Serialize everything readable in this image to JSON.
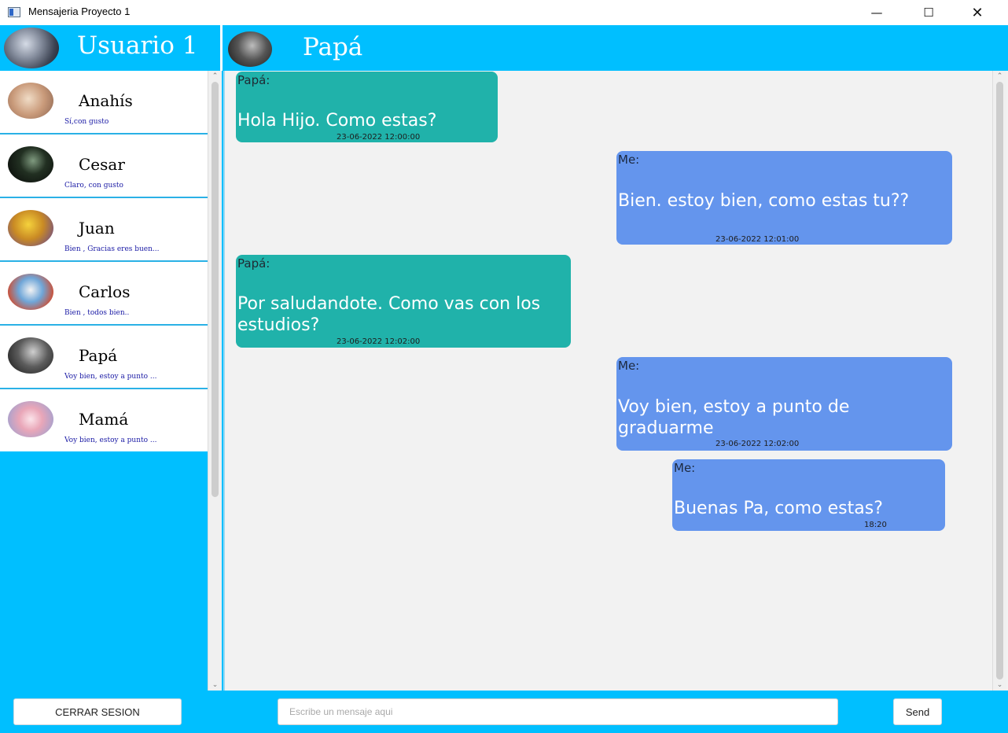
{
  "window": {
    "title": "Mensajeria Proyecto 1",
    "controls": {
      "minimize": "—",
      "maximize": "☐",
      "close": "✕"
    }
  },
  "header": {
    "user_name": "Usuario 1",
    "active_contact": "Papá"
  },
  "sidebar": {
    "chats": [
      {
        "name": "Anahís",
        "last_message": "Sí,con gusto"
      },
      {
        "name": "Cesar",
        "last_message": "Claro, con gusto"
      },
      {
        "name": "Juan",
        "last_message": "Bien , Gracias eres buen..."
      },
      {
        "name": "Carlos",
        "last_message": "Bien , todos bien.."
      },
      {
        "name": "Papá",
        "last_message": "Voy bien, estoy a punto ..."
      },
      {
        "name": "Mamá",
        "last_message": "Voy bien, estoy a punto ..."
      }
    ]
  },
  "messages": [
    {
      "sender": "Papá:",
      "direction": "in",
      "text": "Hola Hijo. Como estas?",
      "time": "23-06-2022 12:00:00"
    },
    {
      "sender": "Me:",
      "direction": "out",
      "text": "Bien. estoy bien, como estas tu??",
      "time": "23-06-2022 12:01:00"
    },
    {
      "sender": "Papá:",
      "direction": "in",
      "text": "Por saludandote. Como vas con los estudios?",
      "time": "23-06-2022 12:02:00"
    },
    {
      "sender": "Me:",
      "direction": "out",
      "text": "Voy bien, estoy a punto de graduarme",
      "time": "23-06-2022 12:02:00"
    },
    {
      "sender": "Me:",
      "direction": "out",
      "text": "Buenas Pa, como estas?",
      "time": "18:20"
    }
  ],
  "bottom_bar": {
    "logout_label": "CERRAR SESION",
    "input_placeholder": "Escribe un mensaje aqui",
    "input_value": "",
    "send_label": "Send"
  },
  "colors": {
    "accent": "#00bfff",
    "incoming_bubble": "#20b2aa",
    "outgoing_bubble": "#6495ed",
    "chat_background": "#f2f2f2"
  },
  "icons": [
    "app-window-icon",
    "minimize-icon",
    "maximize-icon",
    "close-icon",
    "scroll-up-arrow-icon",
    "scroll-down-arrow-icon"
  ]
}
